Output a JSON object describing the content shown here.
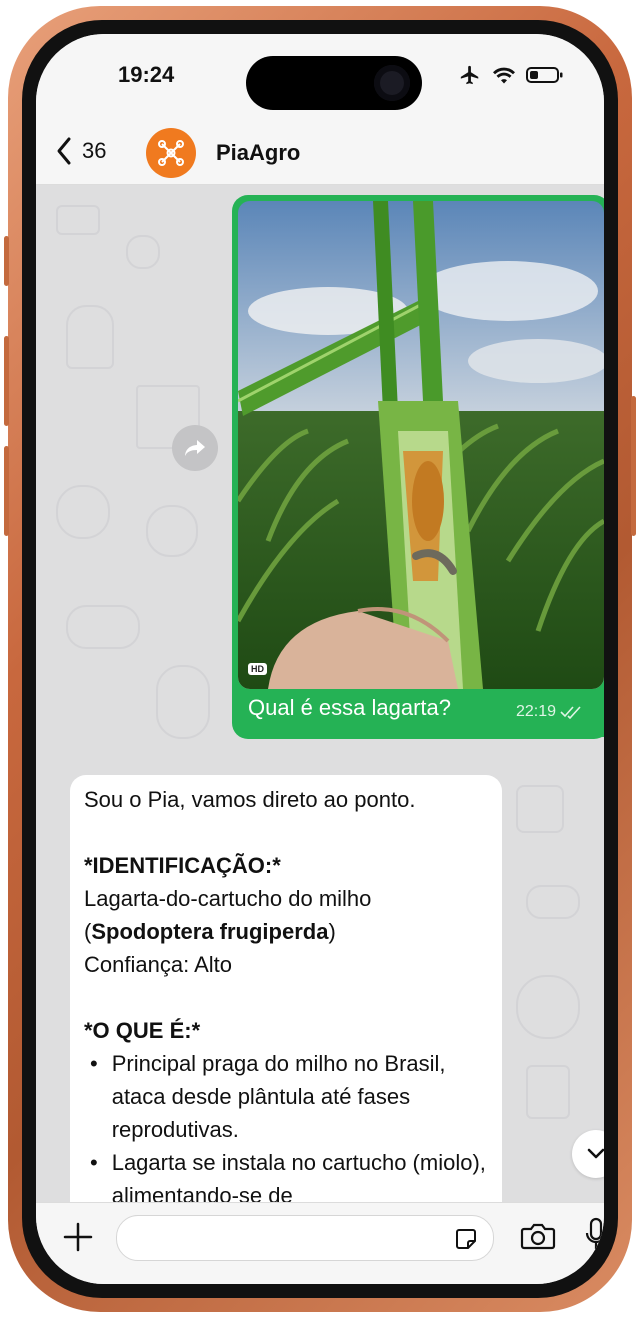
{
  "status_bar": {
    "time": "19:24",
    "icons": [
      "airplane-icon",
      "wifi-icon",
      "battery-icon"
    ]
  },
  "header": {
    "back_count": "36",
    "contact_name": "PiaAgro",
    "avatar_icon": "molecule-network-icon",
    "avatar_color": "#f07a1f"
  },
  "messages": {
    "outgoing": {
      "image_badge": "HD",
      "text": "Qual é essa lagarta?",
      "time": "22:19",
      "status_icon": "double-check-icon",
      "bubble_color": "#25b255"
    },
    "incoming": {
      "line1": "Sou o Pia, vamos direto ao ponto.",
      "identification_heading": "*IDENTIFICAÇÃO:*",
      "identification_name": "Lagarta-do-cartucho do milho",
      "scientific_open": "(",
      "scientific_name": "Spodoptera frugiperda",
      "scientific_close": ")",
      "confidence": "Confiança: Alto",
      "what_heading": "*O QUE É:*",
      "bullets": [
        "Principal praga do milho no Brasil, ataca desde plântula até fases reprodutivas.",
        "Lagarta se instala no cartucho (miolo), alimentando-se de"
      ]
    }
  },
  "input_bar": {
    "placeholder": "",
    "icons": [
      "plus-icon",
      "sticker-icon",
      "camera-icon",
      "microphone-icon"
    ]
  }
}
